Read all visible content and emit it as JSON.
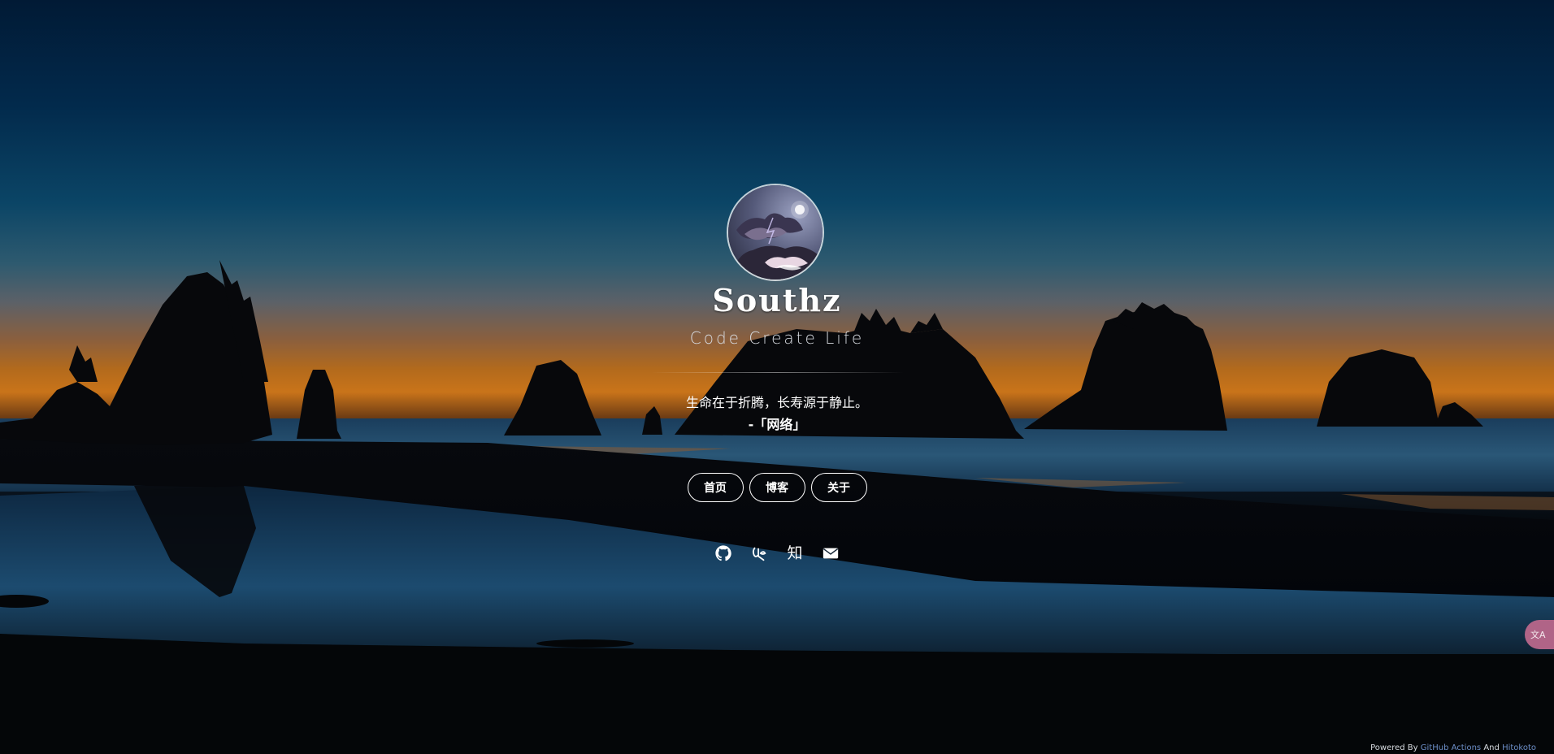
{
  "profile": {
    "name": "Southz",
    "tagline": "Code Create Life"
  },
  "hitokoto": {
    "text": "生命在于折腾，长寿源于静止。",
    "from": "-「网络」"
  },
  "nav": [
    {
      "label": "首页"
    },
    {
      "label": "博客"
    },
    {
      "label": "关于"
    }
  ],
  "socials": [
    {
      "icon": "github-icon"
    },
    {
      "icon": "csdn-icon"
    },
    {
      "icon": "zhihu-icon",
      "glyph": "知"
    },
    {
      "icon": "email-icon"
    }
  ],
  "translate": {
    "label": "文A"
  },
  "footer": {
    "prefix": "Powered By",
    "link1": "GitHub Actions",
    "middle": "And",
    "link2": "Hitokoto"
  },
  "colors": {
    "link": "#6d8fc9",
    "translate_button": "#b06487",
    "sky_top": "#011a35",
    "horizon": "#c9741a"
  }
}
